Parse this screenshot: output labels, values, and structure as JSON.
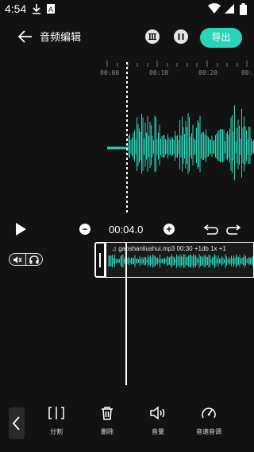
{
  "status_bar": {
    "time": "4:54",
    "icons": [
      "download-icon",
      "app-a-icon",
      "wifi-icon",
      "signal-icon",
      "battery-icon"
    ]
  },
  "top_bar": {
    "title": "音频编辑",
    "export_label": "导出",
    "accent_color": "#2ad4b8",
    "icons": [
      "back-arrow-icon",
      "menu-bars-icon",
      "pause-icon"
    ]
  },
  "timeline": {
    "ticks": [
      "00:00",
      "00:10",
      "00:20",
      "00:"
    ]
  },
  "playback": {
    "current_time": "00:04.0",
    "icons": [
      "play-icon",
      "minus-icon",
      "plus-icon",
      "undo-icon",
      "redo-icon"
    ]
  },
  "track": {
    "label": "♫ gaoshanliushui.mp3  00:30    +1db    1x    +1",
    "icons": [
      "mute-icon",
      "headphones-icon"
    ]
  },
  "tools": [
    {
      "label": "分割",
      "icon": "split-icon"
    },
    {
      "label": "删除",
      "icon": "trash-icon"
    },
    {
      "label": "音量",
      "icon": "volume-icon"
    },
    {
      "label": "音速音调",
      "icon": "speed-gauge-icon"
    }
  ],
  "colors": {
    "background": "#121212",
    "waveform": "#2ad4b8",
    "playhead": "#ffffff"
  }
}
